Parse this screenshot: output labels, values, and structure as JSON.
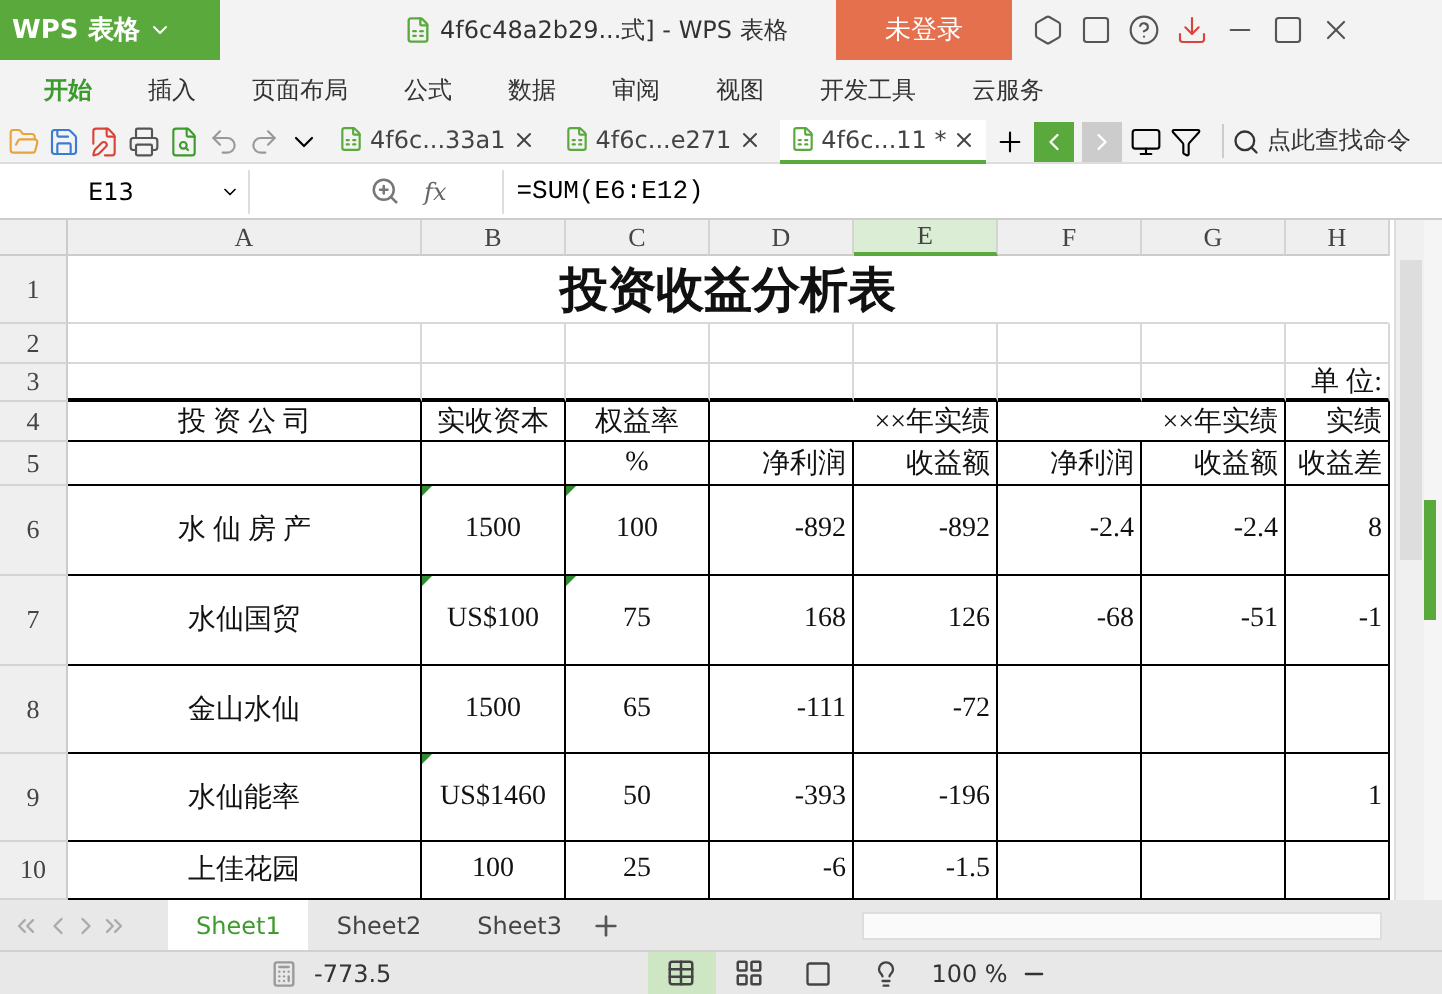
{
  "app": {
    "logo": "WPS 表格",
    "title": "4f6c48a2b29...式] - WPS 表格",
    "login": "未登录"
  },
  "menu": [
    {
      "label": "开始",
      "selected": true
    },
    {
      "label": "插入",
      "selected": false
    },
    {
      "label": "页面布局",
      "selected": false
    },
    {
      "label": "公式",
      "selected": false
    },
    {
      "label": "数据",
      "selected": false
    },
    {
      "label": "审阅",
      "selected": false
    },
    {
      "label": "视图",
      "selected": false
    },
    {
      "label": "开发工具",
      "selected": false
    },
    {
      "label": "云服务",
      "selected": false
    }
  ],
  "doc_tabs": [
    {
      "label": "4f6c...33a1",
      "selected": false
    },
    {
      "label": "4f6c...e271",
      "selected": false
    },
    {
      "label": "4f6c...11 *",
      "selected": true
    }
  ],
  "command_search": {
    "placeholder": "点此查找命令"
  },
  "formula_bar": {
    "cell": "E13",
    "fx": "fx",
    "formula": "=SUM(E6:E12)"
  },
  "columns": [
    {
      "label": "A",
      "selected": false
    },
    {
      "label": "B",
      "selected": false
    },
    {
      "label": "C",
      "selected": false
    },
    {
      "label": "D",
      "selected": false
    },
    {
      "label": "E",
      "selected": true
    },
    {
      "label": "F",
      "selected": false
    },
    {
      "label": "G",
      "selected": false
    },
    {
      "label": "H",
      "selected": false
    }
  ],
  "rows": [
    {
      "num": "1",
      "cells": [
        {
          "text": "投资收益分析表",
          "kind": "title"
        }
      ]
    },
    {
      "num": "2",
      "cells": [
        {},
        {},
        {},
        {},
        {},
        {},
        {},
        {}
      ]
    },
    {
      "num": "3",
      "cells": [
        {},
        {},
        {},
        {},
        {},
        {},
        {},
        {
          "text": "单 位:"
        }
      ]
    },
    {
      "num": "4",
      "cells": [
        {
          "text": "投 资 公 司"
        },
        {
          "text": "实收资本"
        },
        {
          "text": "权益率"
        },
        {
          "text": "××年实绩",
          "kind": "group"
        },
        {
          "text": "××年实绩",
          "kind": "group"
        },
        {
          "text": "实绩"
        }
      ]
    },
    {
      "num": "5",
      "cells": [
        {},
        {},
        {
          "text": "%"
        },
        {
          "text": "净利润"
        },
        {
          "text": "收益额"
        },
        {
          "text": "净利润"
        },
        {
          "text": "收益额"
        },
        {
          "text": "收益差"
        }
      ]
    },
    {
      "num": "6",
      "cells": [
        {
          "text": "水 仙 房 产"
        },
        {
          "text": "1500",
          "flagged": true
        },
        {
          "text": "100",
          "flagged": true
        },
        {
          "text": "-892"
        },
        {
          "text": "-892"
        },
        {
          "text": "-2.4"
        },
        {
          "text": "-2.4"
        },
        {
          "text": "8"
        }
      ]
    },
    {
      "num": "7",
      "cells": [
        {
          "text": "水仙国贸"
        },
        {
          "text": "US$100",
          "flagged": true
        },
        {
          "text": "75",
          "flagged": true
        },
        {
          "text": "168"
        },
        {
          "text": "126"
        },
        {
          "text": "-68"
        },
        {
          "text": "-51"
        },
        {
          "text": "-1"
        }
      ]
    },
    {
      "num": "8",
      "cells": [
        {
          "text": "金山水仙"
        },
        {
          "text": "1500"
        },
        {
          "text": "65"
        },
        {
          "text": "-111"
        },
        {
          "text": "-72"
        },
        {},
        {},
        {}
      ]
    },
    {
      "num": "9",
      "cells": [
        {
          "text": "水仙能率"
        },
        {
          "text": "US$1460",
          "flagged": true
        },
        {
          "text": "50"
        },
        {
          "text": "-393"
        },
        {
          "text": "-196"
        },
        {},
        {},
        {
          "text": "1"
        }
      ]
    },
    {
      "num": "10",
      "cells": [
        {
          "text": "上佳花园"
        },
        {
          "text": "100"
        },
        {
          "text": "25"
        },
        {
          "text": "-6"
        },
        {
          "text": "-1.5"
        },
        {},
        {},
        {}
      ]
    }
  ],
  "sheets": [
    {
      "label": "Sheet1",
      "selected": true
    },
    {
      "label": "Sheet2",
      "selected": false
    },
    {
      "label": "Sheet3",
      "selected": false
    }
  ],
  "status": {
    "sum": "-773.5",
    "zoom": "100 %"
  }
}
